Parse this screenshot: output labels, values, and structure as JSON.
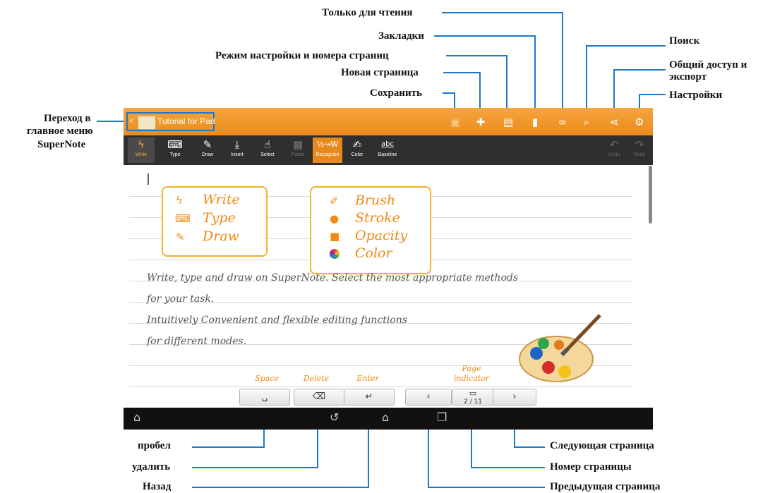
{
  "callouts": {
    "readonly": "Только для чтения",
    "bookmarks": "Закладки",
    "mode_pagenum": "Режим настройки и номера страниц",
    "new_page": "Новая страница",
    "save": "Сохранить",
    "search": "Поиск",
    "share_1": "Общий доступ и",
    "share_2": "экспорт",
    "settings": "Настройки",
    "home_1": "Переход в",
    "home_2": "главное меню",
    "home_3": "SuperNote",
    "space": "пробел",
    "delete": "удалить",
    "back": "Назад",
    "next_page": "Следующая страница",
    "page_number": "Номер страницы",
    "prev_page": "Предыдущая страница"
  },
  "app": {
    "title": "Tutorial for Pad",
    "tools": [
      "Write",
      "Type",
      "Draw",
      "Insert",
      "Select",
      "Paste",
      "Recognize",
      "Color",
      "Baseline"
    ],
    "recognize_glyph": "abc",
    "undo": "Undo",
    "redo": "Redo"
  },
  "bubble_left": [
    "Write",
    "Type",
    "Draw"
  ],
  "bubble_right": [
    "Brush",
    "Stroke",
    "Opacity",
    "Color"
  ],
  "handwriting": [
    "Write, type and draw on SuperNote. Select the most appropriate methods",
    "for your task.",
    "Intuitively Convenient and flexible editing functions",
    "for different modes."
  ],
  "keys": {
    "space": "Space",
    "delete": "Delete",
    "enter": "Enter",
    "page_indicator_1": "Page",
    "page_indicator_2": "indicator",
    "page_current": "2",
    "page_total": "11"
  },
  "colors": {
    "accent": "#ea8a1b",
    "callout_line": "#1e78c8"
  }
}
